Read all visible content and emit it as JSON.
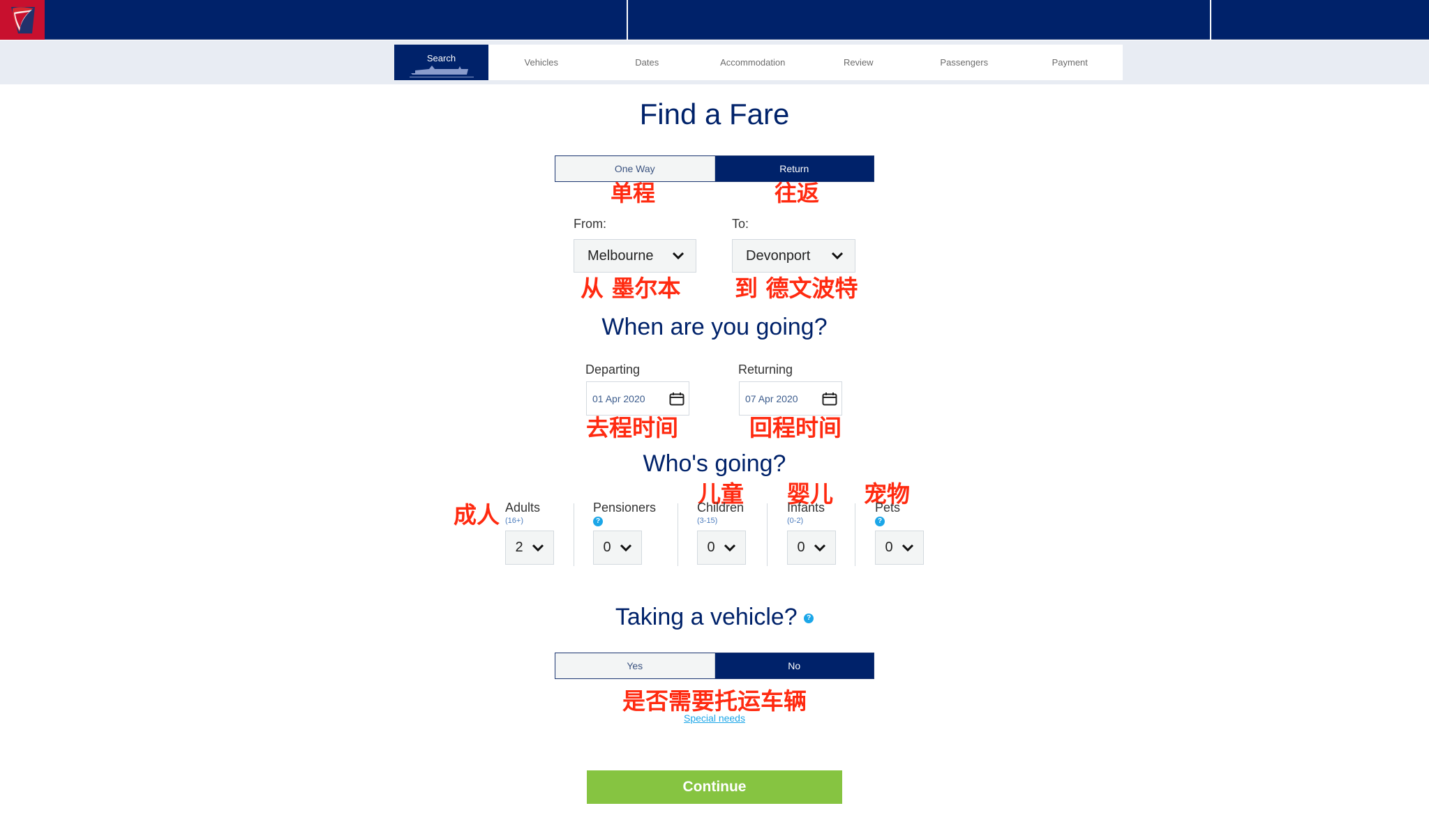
{
  "header": {
    "logo": "spirit-of-tasmania-logo",
    "colors": {
      "brand_navy": "#00226a",
      "brand_red": "#c8102e",
      "accent_green": "#86c441",
      "help_blue": "#1ba6e8"
    }
  },
  "steps": [
    {
      "label": "Search",
      "active": true
    },
    {
      "label": "Vehicles",
      "active": false
    },
    {
      "label": "Dates",
      "active": false
    },
    {
      "label": "Accommodation",
      "active": false
    },
    {
      "label": "Review",
      "active": false
    },
    {
      "label": "Passengers",
      "active": false
    },
    {
      "label": "Payment",
      "active": false
    }
  ],
  "page_title": "Find a Fare",
  "trip_type": {
    "options": [
      "One Way",
      "Return"
    ],
    "selected": "Return",
    "annotations": [
      "单程",
      "往返"
    ]
  },
  "route": {
    "from_label": "From:",
    "from_value": "Melbourne",
    "to_label": "To:",
    "to_value": "Devonport",
    "from_annotation": "从 墨尔本",
    "to_annotation": "到 德文波特"
  },
  "dates": {
    "heading": "When are you going?",
    "departing_label": "Departing",
    "departing_value": "01 Apr 2020",
    "returning_label": "Returning",
    "returning_value": "07 Apr 2020",
    "departing_annotation": "去程时间",
    "returning_annotation": "回程时间"
  },
  "passengers": {
    "heading": "Who's going?",
    "groups": [
      {
        "name": "Adults",
        "sub": "(16+)",
        "help": false,
        "value": "2",
        "annotation": "成人"
      },
      {
        "name": "Pensioners",
        "sub": "",
        "help": true,
        "value": "0",
        "annotation": ""
      },
      {
        "name": "Children",
        "sub": "(3-15)",
        "help": false,
        "value": "0",
        "annotation": "儿童"
      },
      {
        "name": "Infants",
        "sub": "(0-2)",
        "help": false,
        "value": "0",
        "annotation": "婴儿"
      },
      {
        "name": "Pets",
        "sub": "",
        "help": true,
        "value": "0",
        "annotation": "宠物"
      }
    ]
  },
  "vehicle": {
    "heading": "Taking a vehicle?",
    "options": [
      "Yes",
      "No"
    ],
    "selected": "No",
    "annotation": "是否需要托运车辆",
    "special_needs_link": "Special needs"
  },
  "continue_label": "Continue"
}
